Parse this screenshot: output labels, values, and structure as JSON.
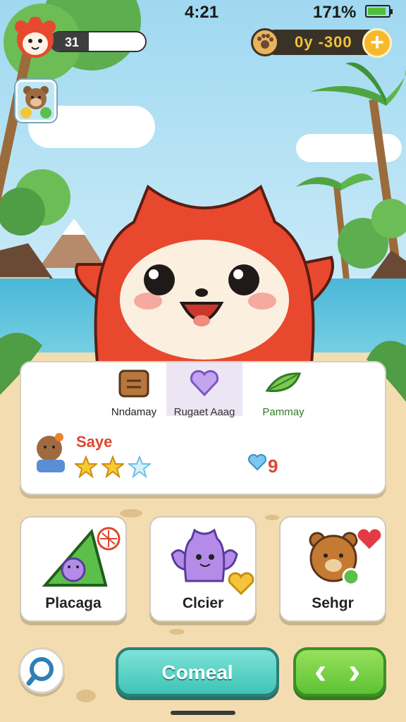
{
  "status_bar": {
    "time": "4:21",
    "battery": "171%",
    "battery_level": 0.9
  },
  "hud": {
    "player_level": "31",
    "xp_fraction": 0.4,
    "currency": "0y -300",
    "plus_symbol": "+"
  },
  "tabs": [
    {
      "label": "Nndamay",
      "icon": "chest-icon",
      "active": false
    },
    {
      "label": "Rugaet Aaag",
      "icon": "heart-icon",
      "active": true
    },
    {
      "label": "Pammay",
      "icon": "leaf-icon",
      "active": false
    }
  ],
  "pet": {
    "name": "Saye",
    "stars_filled": 2,
    "stars_total": 3,
    "hearts": "9"
  },
  "cards": [
    {
      "label": "Placaga",
      "icon": "pyramid-icon",
      "badge": "globe-icon"
    },
    {
      "label": "Clcier",
      "icon": "purple-cat-icon",
      "badge": "heart-icon"
    },
    {
      "label": "Sehgr",
      "icon": "bear-icon",
      "badge": "heart-icon"
    }
  ],
  "main_button": {
    "label": "Comeal"
  },
  "nav_button": {
    "left": "‹",
    "right": "›"
  },
  "colors": {
    "mascot": "#e8482e",
    "accent_teal": "#3ec4b6",
    "accent_green": "#5ec234",
    "coin": "#f2c23c",
    "pet_name": "#e0452e"
  }
}
